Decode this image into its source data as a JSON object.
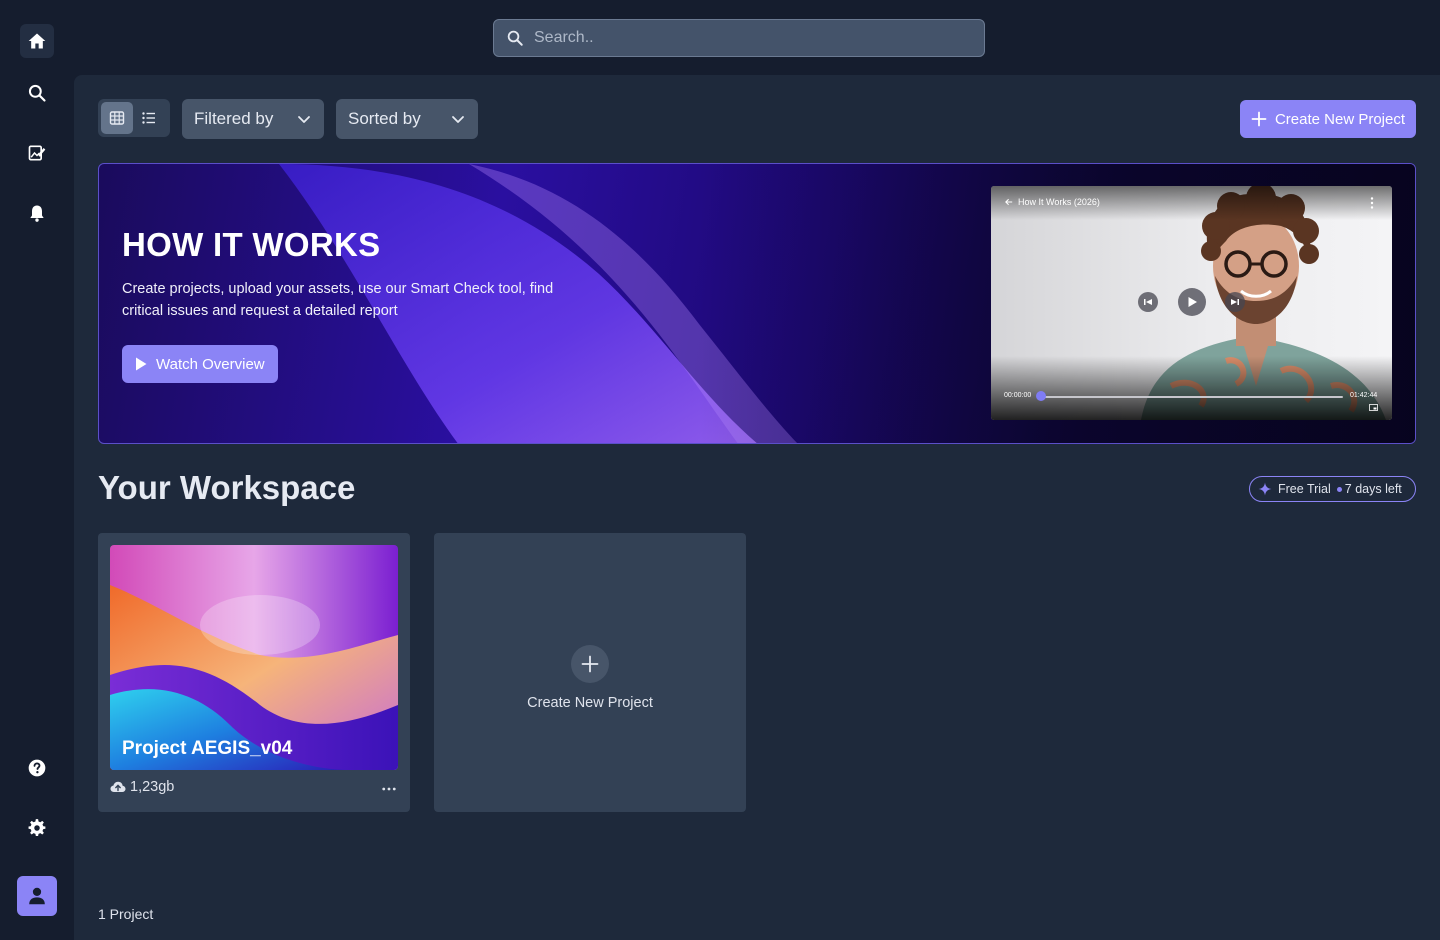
{
  "sidebar": {
    "items": [
      {
        "name": "home",
        "icon": "home-icon",
        "active": true
      },
      {
        "name": "search",
        "icon": "search-icon"
      },
      {
        "name": "edit-image",
        "icon": "edit-image-icon"
      },
      {
        "name": "notifications",
        "icon": "bell-icon"
      }
    ],
    "bottom": [
      {
        "name": "help",
        "icon": "help-icon"
      },
      {
        "name": "settings",
        "icon": "gear-icon"
      },
      {
        "name": "profile",
        "icon": "user-icon"
      }
    ]
  },
  "search": {
    "placeholder": "Search.."
  },
  "toolbar": {
    "view_modes": [
      "grid",
      "list"
    ],
    "active_view": "grid",
    "filter_label": "Filtered by",
    "sort_label": "Sorted by",
    "create_label": "Create New Project"
  },
  "hero": {
    "title": "HOW IT WORKS",
    "description": "Create projects, upload your assets, use our Smart Check tool, find critical issues and request a detailed report",
    "button_label": "Watch Overview",
    "video": {
      "title": "How It Works (2026)",
      "time_start": "00:00:00",
      "time_end": "01:42:44",
      "progress": 0
    }
  },
  "workspace": {
    "title": "Your Workspace",
    "trial_label": "Free Trial",
    "trial_days": "7 days left",
    "projects": [
      {
        "name": "Project AEGIS_v04",
        "size": "1,23gb"
      }
    ],
    "new_project_label": "Create New Project",
    "count_label": "1 Project"
  },
  "colors": {
    "accent": "#8b84f6",
    "background": "#151d2e",
    "panel": "#1e293b",
    "card": "#334155"
  }
}
